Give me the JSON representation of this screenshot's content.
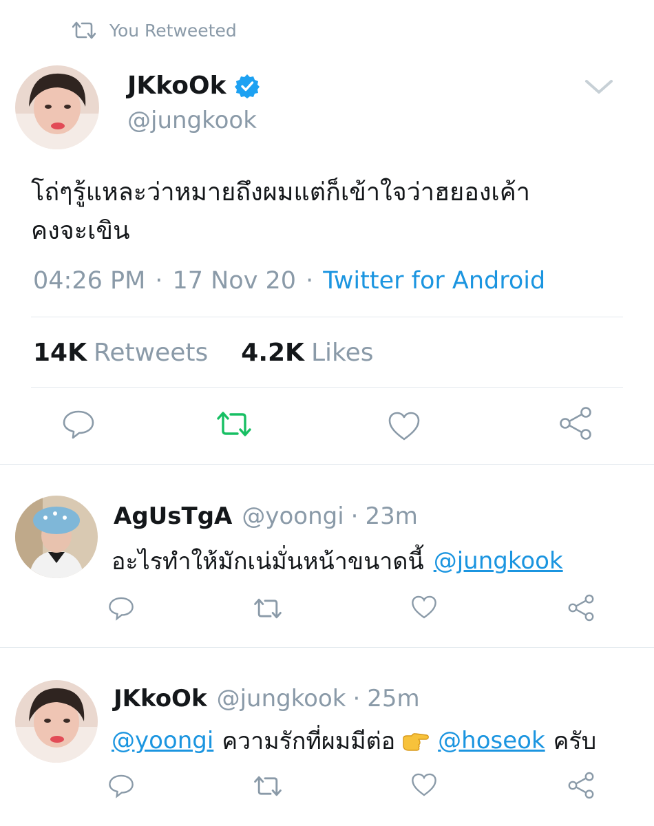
{
  "retweet_banner": {
    "icon": "retweet-icon",
    "label": "You Retweeted"
  },
  "tweet": {
    "author_name": "JKkoOk",
    "verified_icon": "verified-badge-icon",
    "handle": "@jungkook",
    "text_line1": "โถ่ๆรู้แหละว่าหมายถึงผมแต่ก็เข้าใจว่าฮยองเค้า",
    "text_line2": "คงจะเขิน",
    "time": "04:26 PM",
    "date": "17 Nov 20",
    "separator": "·",
    "source": "Twitter for Android",
    "retweets_count": "14K",
    "retweets_label": "Retweets",
    "likes_count": "4.2K",
    "likes_label": "Likes",
    "actions": [
      "reply-icon",
      "retweet-icon",
      "like-icon",
      "share-icon"
    ]
  },
  "replies": [
    {
      "name": "AgUsTgA",
      "handle": "@yoongi",
      "separator": "·",
      "time": "23m",
      "text": "อะไรทำให้มักเน่มั่นหน้าขนาดนี้",
      "mention": "@jungkook"
    },
    {
      "name": "JKkoOk",
      "handle": "@jungkook",
      "separator": "·",
      "time": "25m",
      "mention1": "@yoongi",
      "text": "ความรักที่ผมมีต่อ",
      "emoji": "backhand-index-pointing-right-emoji",
      "mention2": "@hoseok",
      "text_end": "ครับ"
    }
  ],
  "colors": {
    "accent": "#1b95e0",
    "retweeted_green": "#17bf63",
    "muted": "#8a9aa8",
    "divider": "#e1e8ed"
  }
}
